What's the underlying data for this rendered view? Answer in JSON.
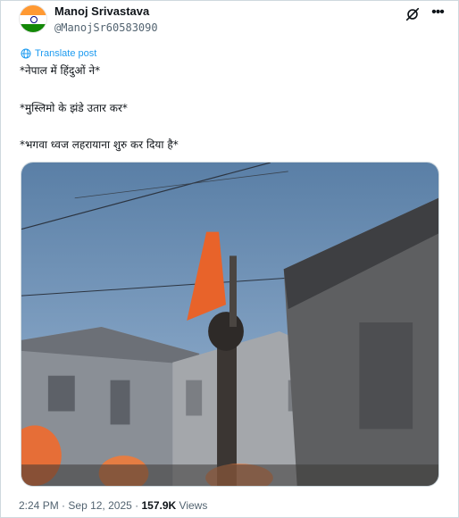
{
  "post": {
    "author_name": "Manoj Srivastava",
    "author_handle": "@ManojSr60583090",
    "translate_label": "Translate post",
    "lines": [
      "*नेपाल में हिंदुओं ने*",
      "*मुस्लिमो के झंडे उतार कर*",
      "*भगवा ध्वज लहरायाना शुरु कर दिया है*"
    ],
    "time": "2:24 PM",
    "separator": "·",
    "date": "Sep 12, 2025",
    "views_count": "157.9K",
    "views_label": "Views"
  },
  "icons": {
    "avatar": "india-flag-avatar",
    "grok": "grok-icon",
    "more": "more-options-icon",
    "translate": "globe-icon"
  },
  "colors": {
    "accent": "#1d9bf0",
    "muted": "#536471",
    "text": "#0f1419",
    "flag_saffron": "#ff9933",
    "flag_green": "#138808",
    "saffron_flag_in_video": "#e8632a"
  }
}
